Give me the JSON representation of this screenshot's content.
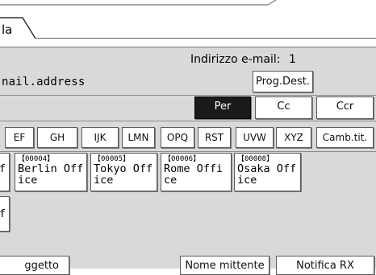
{
  "tab": {
    "label": "la"
  },
  "email": {
    "count_label": "Indirizzo e-mail:",
    "count_value": "1",
    "address": "nail.address",
    "prog_dest_label": "Prog.Dest."
  },
  "recipient_type": {
    "per": "Per",
    "cc": "Cc",
    "ccr": "Ccr",
    "selected": "Per"
  },
  "index_tabs": [
    "EF",
    "GH",
    "IJK",
    "LMN",
    "OPQ",
    "RST",
    "UVW",
    "XYZ"
  ],
  "change_title_label": "Camb.tit.",
  "destinations": [
    {
      "code": "",
      "name": "f"
    },
    {
      "code": "【00004】",
      "name": "Berlin Office"
    },
    {
      "code": "【00005】",
      "name": "Tokyo Office"
    },
    {
      "code": "【00006】",
      "name": "Rome Office"
    },
    {
      "code": "【00008】",
      "name": "Osaka Office"
    },
    {
      "code": "",
      "name": "f"
    }
  ],
  "bottom": {
    "subject_label": "ggetto",
    "sender_name_label": "Nome mittente",
    "rx_notice_label": "Notifica RX"
  },
  "colors": {
    "panel": "#d9d9d9",
    "button_bg": "#ffffff",
    "selected_bg": "#1a1a1a",
    "selected_text": "#ffffff"
  }
}
